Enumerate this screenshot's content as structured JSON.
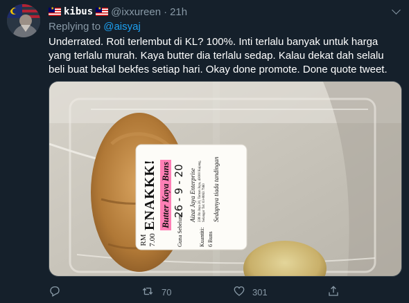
{
  "tweet": {
    "display_name": "kibus",
    "handle": "@ixxureen",
    "separator": "·",
    "time": "21h",
    "replying_prefix": "Replying to",
    "replying_to": "@aisyaj",
    "text": "Underrated. Roti terlembut di KL? 100%. Inti terlalu banyak untuk harga yang terlalu murah. Kaya butter dia terlalu sedap. Kalau dekat dah selalu beli buat bekal bekfes setiap hari. Okay done promote. Done quote tweet."
  },
  "label": {
    "price_label": "RM",
    "price": "7.00",
    "brand": "ENAKKK!",
    "product": "Butter Kaya Buns",
    "date": "26 - 9 - 20",
    "qty_label": "Kuantiti:",
    "qty": "6 Buns",
    "best_before": "Guna Sebelum:",
    "company": "Aizat Jaya Enterprise",
    "address": "238 Jln Jaya 20, Taman Jaya, 43000 Kajang, Selangor  Tel: 03-8063 7960",
    "tagline": "Sedapnya tiada tandingan"
  },
  "actions": {
    "reply_count": "",
    "retweet_count": "70",
    "like_count": "301"
  },
  "icons": {
    "reply": "reply-icon",
    "retweet": "retweet-icon",
    "like": "heart-icon",
    "share": "share-icon",
    "more": "chevron-down-icon"
  },
  "colors": {
    "background": "#15202b",
    "muted": "#8899a6",
    "link": "#1da1f2",
    "border": "#38444d"
  }
}
